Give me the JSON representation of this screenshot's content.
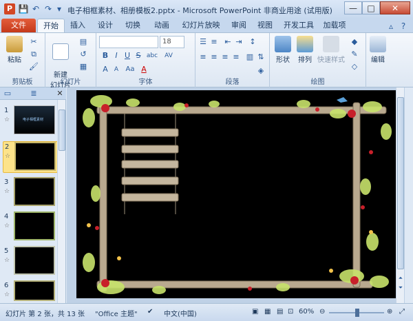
{
  "window": {
    "app_icon": "P",
    "title": "电子相框素材、相册模板2.pptx - Microsoft PowerPoint 非商业用途 (试用版)",
    "buttons": {
      "minimize": "—",
      "maximize": "□",
      "close": "✕"
    }
  },
  "quick_access": {
    "save_icon": "💾",
    "undo_icon": "↶",
    "redo_icon": "↷",
    "customize_icon": "▾"
  },
  "tabs": [
    "文件",
    "开始",
    "插入",
    "设计",
    "切换",
    "动画",
    "幻灯片放映",
    "审阅",
    "视图",
    "开发工具",
    "加载项"
  ],
  "active_tab": "开始",
  "ribbon": {
    "clipboard": {
      "label": "剪贴板",
      "paste": "粘贴"
    },
    "slides": {
      "label": "幻灯片",
      "new_slide": "新建\n幻灯片"
    },
    "font": {
      "label": "字体",
      "font_name": "",
      "font_size": "18",
      "bold": "B",
      "italic": "I",
      "underline": "U",
      "strike": "S",
      "shadow": "abc",
      "spacing": "AV",
      "case": "Aa",
      "color": "A",
      "grow": "A",
      "shrink": "A"
    },
    "paragraph": {
      "label": "段落"
    },
    "drawing": {
      "label": "绘图",
      "shapes": "形状",
      "arrange": "排列",
      "quick_styles": "快速样式"
    },
    "editing": {
      "label": "编辑",
      "edit": "编辑"
    }
  },
  "slide_panel": {
    "slides": [
      {
        "num": "1",
        "star": "☆",
        "caption": "电子相框素材"
      },
      {
        "num": "2",
        "star": "☆"
      },
      {
        "num": "3",
        "star": "☆"
      },
      {
        "num": "4",
        "star": "☆"
      },
      {
        "num": "5",
        "star": "☆"
      },
      {
        "num": "6",
        "star": "☆"
      }
    ],
    "selected": "2"
  },
  "status_bar": {
    "slide_info": "幻灯片 第 2 张，共 13 张",
    "theme": "\"Office 主题\"",
    "language": "中文(中国)",
    "zoom": "60%"
  },
  "colors": {
    "frame_wood": "#b9a98f",
    "flower_red": "#c8202a",
    "leaf_green": "#c8e36b",
    "accent_orange": "#d24726"
  }
}
